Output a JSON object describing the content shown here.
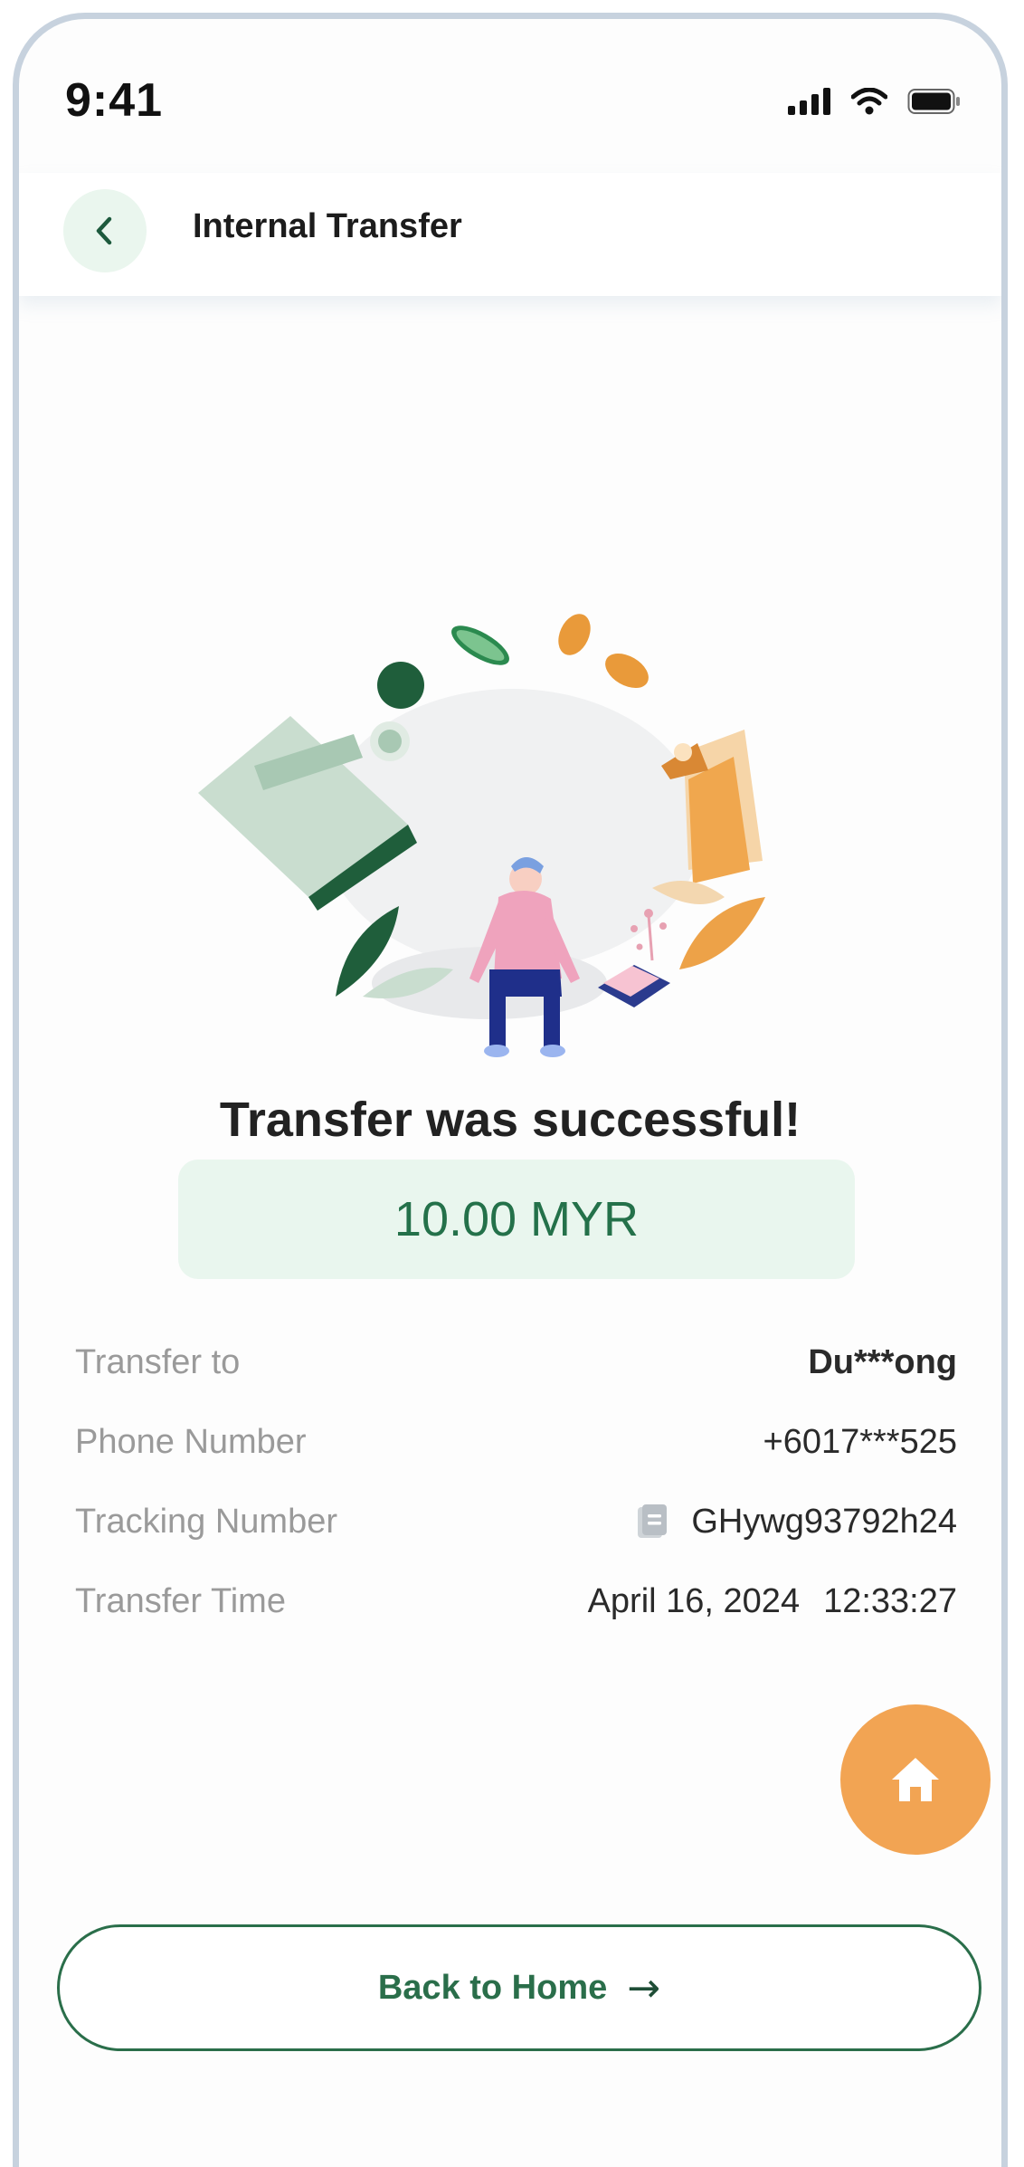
{
  "status_bar": {
    "time": "9:41",
    "icons": [
      "signal-icon",
      "wifi-icon",
      "battery-icon"
    ]
  },
  "header": {
    "back_icon": "chevron-left-icon",
    "title": "Internal Transfer"
  },
  "result": {
    "illustration": "money-transfer-illustration",
    "title": "Transfer was successful!",
    "amount": "10.00 MYR"
  },
  "details": {
    "rows": [
      {
        "label": "Transfer to",
        "value": "Du***ong"
      },
      {
        "label": "Phone Number",
        "value": "+6017***525"
      },
      {
        "label": "Tracking Number",
        "value": "GHywg93792h24",
        "icon": "copy-document-icon"
      },
      {
        "label": "Transfer Time",
        "value": "April 16, 2024",
        "value2": "12:33:27"
      }
    ]
  },
  "fab": {
    "icon": "home-icon"
  },
  "footer": {
    "back_home_label": "Back to Home",
    "arrow_icon": "arrow-right-icon",
    "arrow_glyph": "→"
  },
  "colors": {
    "primary_green": "#2a6e4a",
    "amount_bg": "#e9f6ee",
    "fab_orange": "#f2a453",
    "frame_border": "#c7d2de"
  }
}
